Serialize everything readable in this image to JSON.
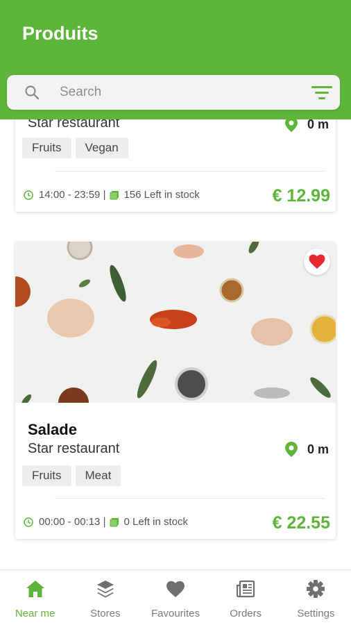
{
  "header": {
    "title": "Produits"
  },
  "search": {
    "placeholder": "Search",
    "search_icon": "search-icon",
    "filter_icon": "filter-icon"
  },
  "products": [
    {
      "title": "",
      "store": "Star restaurant",
      "distance": "0 m",
      "tags": [
        "Fruits",
        "Vegan"
      ],
      "hours": "14:00 - 23:59 |",
      "stock": "156 Left in stock",
      "price": "€ 12.99"
    },
    {
      "title": "Salade",
      "store": "Star restaurant",
      "distance": "0 m",
      "tags": [
        "Fruits",
        "Meat"
      ],
      "hours": "00:00 - 00:13 |",
      "stock": "0 Left in stock",
      "price": "€ 22.55",
      "favourite": true
    }
  ],
  "tabs": [
    {
      "label": "Near me",
      "icon": "home-icon",
      "active": true
    },
    {
      "label": "Stores",
      "icon": "layers-icon",
      "active": false
    },
    {
      "label": "Favourites",
      "icon": "heart-icon",
      "active": false
    },
    {
      "label": "Orders",
      "icon": "newspaper-icon",
      "active": false
    },
    {
      "label": "Settings",
      "icon": "gear-icon",
      "active": false
    }
  ],
  "colors": {
    "brand_green": "#5db53a",
    "favourite_red": "#e8292f",
    "inactive_gray": "#7a7a7a"
  }
}
